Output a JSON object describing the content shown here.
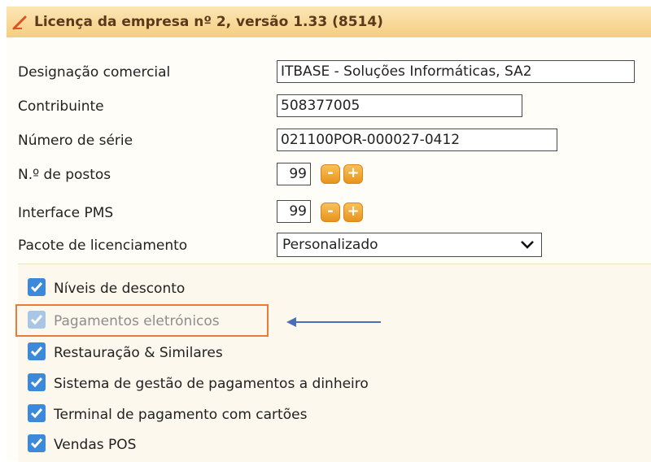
{
  "window": {
    "title": "Licença da empresa nº 2, versão 1.33 (8514)",
    "icon": "pencil-icon"
  },
  "form": {
    "designacao": {
      "label": "Designação comercial",
      "value": "ITBASE - Soluções Informáticas, SA2"
    },
    "contribuinte": {
      "label": "Contribuinte",
      "value": "508377005"
    },
    "numero_serie": {
      "label": "Número de série",
      "value": "021100POR-000027-0412"
    },
    "postos": {
      "label": "N.º de postos",
      "value": "99",
      "minus": "-",
      "plus": "+"
    },
    "pms": {
      "label": "Interface PMS",
      "value": "99",
      "minus": "-",
      "plus": "+"
    },
    "pacote": {
      "label": "Pacote de licenciamento",
      "selected": "Personalizado"
    }
  },
  "modules": [
    {
      "label": "Níveis de desconto",
      "checked": true,
      "disabled": false
    },
    {
      "label": "Pagamentos eletrónicos",
      "checked": true,
      "disabled": true
    },
    {
      "label": "Restauração & Similares",
      "checked": true,
      "disabled": false
    },
    {
      "label": "Sistema de gestão de pagamentos a dinheiro",
      "checked": true,
      "disabled": false
    },
    {
      "label": "Terminal de pagamento com cartões",
      "checked": true,
      "disabled": false
    },
    {
      "label": "Vendas POS",
      "checked": true,
      "disabled": false
    }
  ],
  "colors": {
    "accent": "#f6cd82",
    "stepper": "#e8941c",
    "checkbox": "#3c88d9",
    "highlight": "#ee7a38",
    "arrow": "#4a6fb5"
  }
}
